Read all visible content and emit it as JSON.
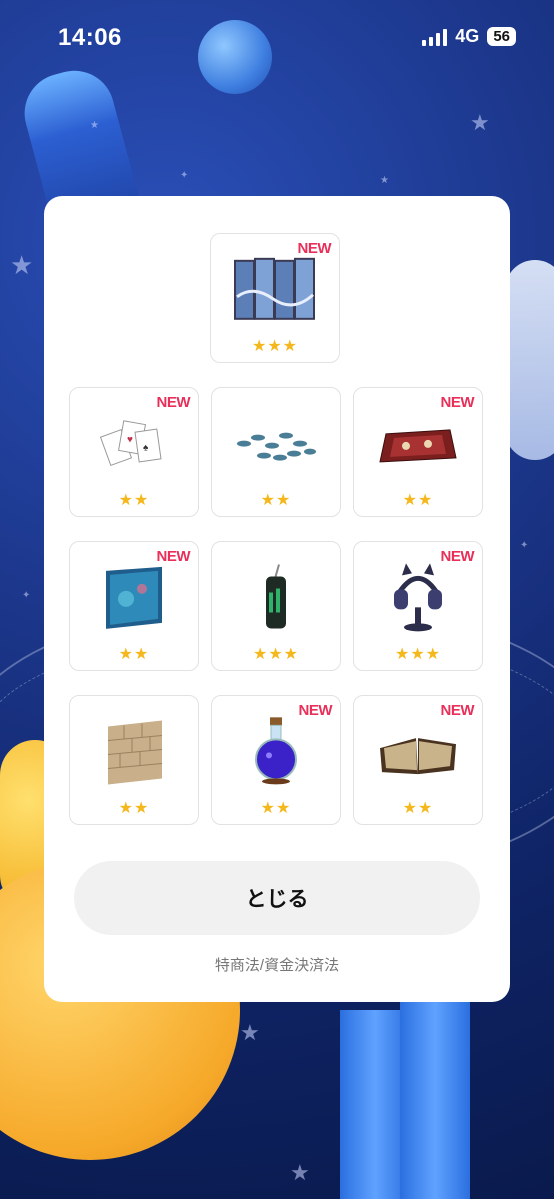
{
  "status_bar": {
    "time": "14:06",
    "network": "4G",
    "battery": "56"
  },
  "items": [
    {
      "name": "folding-screen",
      "stars": "★★★",
      "new": "NEW"
    },
    {
      "name": "playing-cards",
      "stars": "★★",
      "new": "NEW"
    },
    {
      "name": "fish-school",
      "stars": "★★",
      "new": ""
    },
    {
      "name": "patterned-rug",
      "stars": "★★",
      "new": "NEW"
    },
    {
      "name": "aquarium-wall",
      "stars": "★★",
      "new": "NEW"
    },
    {
      "name": "drink-can",
      "stars": "★★★",
      "new": ""
    },
    {
      "name": "cat-ear-headphones",
      "stars": "★★★",
      "new": "NEW"
    },
    {
      "name": "brick-wall",
      "stars": "★★",
      "new": ""
    },
    {
      "name": "potion-flask",
      "stars": "★★",
      "new": "NEW"
    },
    {
      "name": "open-book",
      "stars": "★★",
      "new": "NEW"
    }
  ],
  "dialog": {
    "close_label": "とじる",
    "legal_link": "特商法/資金決済法"
  },
  "colors": {
    "new_badge": "#e8305a",
    "star": "#f5b81c",
    "background": "#1b3588"
  }
}
